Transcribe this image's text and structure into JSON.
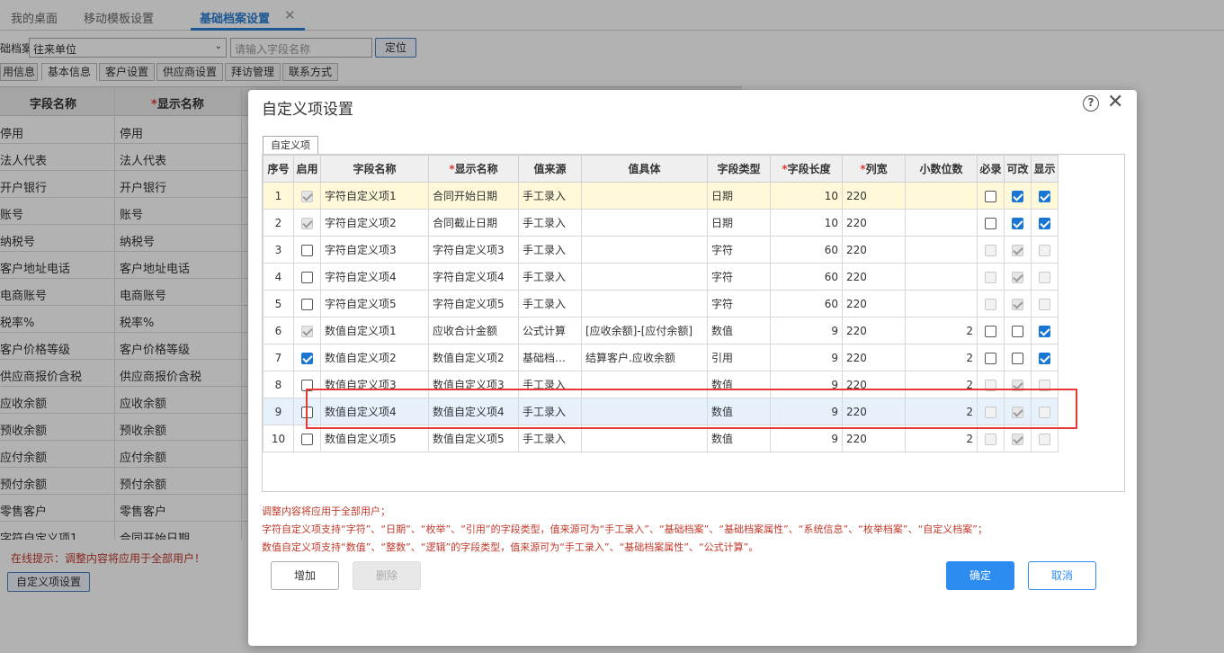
{
  "page_tabs": [
    {
      "label": "我的桌面"
    },
    {
      "label": "移动模板设置"
    },
    {
      "label": "基础档案设置"
    }
  ],
  "filter": {
    "label": "础档案",
    "select_value": "往来单位",
    "search_placeholder": "请输入字段名称",
    "locate_label": "定位"
  },
  "sub_tabs": [
    {
      "label": "用信息"
    },
    {
      "label": "基本信息"
    },
    {
      "label": "客户设置"
    },
    {
      "label": "供应商设置"
    },
    {
      "label": "拜访管理"
    },
    {
      "label": "联系方式"
    }
  ],
  "bg_grid": {
    "headers": [
      "字段名称",
      "显示名称"
    ],
    "rows": [
      [
        "停用",
        "停用"
      ],
      [
        "法人代表",
        "法人代表"
      ],
      [
        "开户银行",
        "开户银行"
      ],
      [
        "账号",
        "账号"
      ],
      [
        "纳税号",
        "纳税号"
      ],
      [
        "客户地址电话",
        "客户地址电话"
      ],
      [
        "电商账号",
        "电商账号"
      ],
      [
        "税率%",
        "税率%"
      ],
      [
        "客户价格等级",
        "客户价格等级"
      ],
      [
        "供应商报价含税",
        "供应商报价含税"
      ],
      [
        "应收余额",
        "应收余额"
      ],
      [
        "预收余额",
        "预收余额"
      ],
      [
        "应付余额",
        "应付余额"
      ],
      [
        "预付余额",
        "预付余额"
      ],
      [
        "零售客户",
        "零售客户"
      ],
      [
        "字符自定义项1",
        "合同开始日期"
      ]
    ]
  },
  "bg_tip": "在线提示：调整内容将应用于全部用户！",
  "bg_custom_button": "自定义项设置",
  "modal": {
    "title": "自定义项设置",
    "inner_tab": "自定义项",
    "columns": [
      "序号",
      "启用",
      "字段名称",
      "显示名称",
      "值来源",
      "值具体",
      "字段类型",
      "字段长度",
      "列宽",
      "小数位数",
      "必录",
      "可改",
      "显示"
    ],
    "rows": [
      {
        "no": "1",
        "enabled": "dison",
        "field": "字符自定义项1",
        "display": "合同开始日期",
        "source": "手工录入",
        "detail": "",
        "type": "日期",
        "length": "10",
        "width": "220",
        "decimals": "",
        "required": "off",
        "editable": "on",
        "show": "on"
      },
      {
        "no": "2",
        "enabled": "dison",
        "field": "字符自定义项2",
        "display": "合同截止日期",
        "source": "手工录入",
        "detail": "",
        "type": "日期",
        "length": "10",
        "width": "220",
        "decimals": "",
        "required": "off",
        "editable": "on",
        "show": "on"
      },
      {
        "no": "3",
        "enabled": "off",
        "field": "字符自定义项3",
        "display": "字符自定义项3",
        "source": "手工录入",
        "detail": "",
        "type": "字符",
        "length": "60",
        "width": "220",
        "decimals": "",
        "required": "dis",
        "editable": "dison",
        "show": "dis"
      },
      {
        "no": "4",
        "enabled": "off",
        "field": "字符自定义项4",
        "display": "字符自定义项4",
        "source": "手工录入",
        "detail": "",
        "type": "字符",
        "length": "60",
        "width": "220",
        "decimals": "",
        "required": "dis",
        "editable": "dison",
        "show": "dis"
      },
      {
        "no": "5",
        "enabled": "off",
        "field": "字符自定义项5",
        "display": "字符自定义项5",
        "source": "手工录入",
        "detail": "",
        "type": "字符",
        "length": "60",
        "width": "220",
        "decimals": "",
        "required": "dis",
        "editable": "dison",
        "show": "dis"
      },
      {
        "no": "6",
        "enabled": "dison",
        "field": "数值自定义项1",
        "display": "应收合计金额",
        "source": "公式计算",
        "detail": "[应收余额]-[应付余额]",
        "type": "数值",
        "length": "9",
        "width": "220",
        "decimals": "2",
        "required": "off",
        "editable": "off",
        "show": "on"
      },
      {
        "no": "7",
        "enabled": "on",
        "field": "数值自定义项2",
        "display": "数值自定义项2",
        "source": "基础档…",
        "detail": "结算客户.应收余额",
        "type": "引用",
        "length": "9",
        "width": "220",
        "decimals": "2",
        "required": "off",
        "editable": "off",
        "show": "on"
      },
      {
        "no": "8",
        "enabled": "off",
        "field": "数值自定义项3",
        "display": "数值自定义项3",
        "source": "手工录入",
        "detail": "",
        "type": "数值",
        "length": "9",
        "width": "220",
        "decimals": "2",
        "required": "dis",
        "editable": "dison",
        "show": "dis"
      },
      {
        "no": "9",
        "enabled": "off",
        "field": "数值自定义项4",
        "display": "数值自定义项4",
        "source": "手工录入",
        "detail": "",
        "type": "数值",
        "length": "9",
        "width": "220",
        "decimals": "2",
        "required": "dis",
        "editable": "dison",
        "show": "dis"
      },
      {
        "no": "10",
        "enabled": "off",
        "field": "数值自定义项5",
        "display": "数值自定义项5",
        "source": "手工录入",
        "detail": "",
        "type": "数值",
        "length": "9",
        "width": "220",
        "decimals": "2",
        "required": "dis",
        "editable": "dison",
        "show": "dis"
      }
    ],
    "notes": [
      "调整内容将应用于全部用户；",
      "字符自定义项支持“字符”、“日期”、“枚举”、“引用”的字段类型，值来源可为“手工录入”、“基础档案”、“基础档案属性”、“系统信息”、“枚举档案”、“自定义档案”；",
      "数值自定义项支持“数值”、“整数”、“逻辑”的字段类型，值来源可为“手工录入”、“基础档案属性”、“公式计算”。"
    ],
    "buttons": {
      "add": "增加",
      "delete": "删除",
      "ok": "确定",
      "cancel": "取消"
    }
  },
  "colors": {
    "accent": "#2d8cf0",
    "highlight_box": "#e53935",
    "note_text": "#c0392b"
  }
}
